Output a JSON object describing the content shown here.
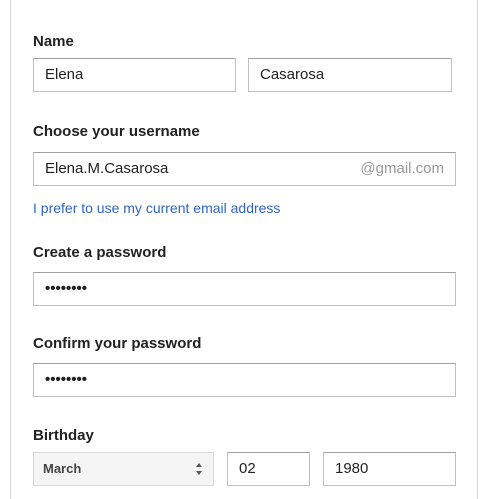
{
  "name": {
    "label": "Name",
    "first_value": "Elena",
    "last_value": "Casarosa"
  },
  "username": {
    "label": "Choose your username",
    "value": "Elena.M.Casarosa",
    "suffix": "@gmail.com",
    "alt_link": "I prefer to use my current email address"
  },
  "password": {
    "label": "Create a password",
    "masked_value": "••••••••"
  },
  "confirm_password": {
    "label": "Confirm your password",
    "masked_value": "••••••••"
  },
  "birthday": {
    "label": "Birthday",
    "month_selected": "March",
    "day_value": "02",
    "year_value": "1980"
  },
  "icons": {
    "month_select_arrows": "up-down-chevron-icon"
  },
  "colors": {
    "link": "#2f64c2",
    "label_text": "#222222",
    "suffix_text": "#999999",
    "input_border": "#c0c0c0"
  }
}
